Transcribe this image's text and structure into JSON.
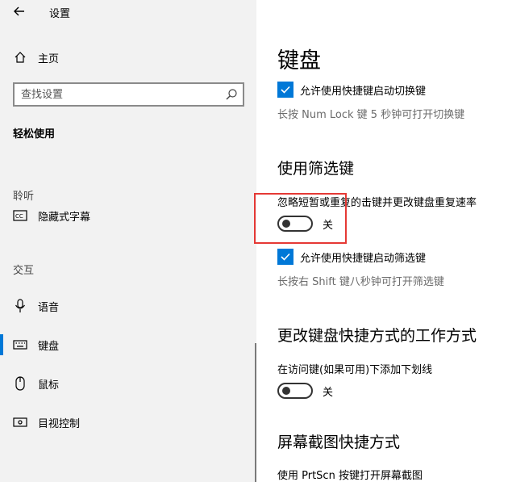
{
  "window": {
    "title": "设置"
  },
  "sidebar": {
    "home_label": "主页",
    "search_placeholder": "查找设置",
    "category": "轻松使用",
    "groups": [
      {
        "label": "聆听",
        "items": [
          {
            "label": "隐藏式字幕",
            "icon": "closed-captions-icon"
          }
        ]
      },
      {
        "label": "交互",
        "items": [
          {
            "label": "语音",
            "icon": "microphone-icon"
          },
          {
            "label": "键盘",
            "icon": "keyboard-icon",
            "selected": true
          },
          {
            "label": "鼠标",
            "icon": "mouse-icon"
          },
          {
            "label": "目视控制",
            "icon": "eye-control-icon"
          }
        ]
      }
    ]
  },
  "main": {
    "title": "键盘",
    "toggle_keys_shortcut": {
      "label": "允许使用快捷键启动切换键",
      "checked": true,
      "desc": "长按 Num Lock 键 5 秒钟可打开切换键"
    },
    "filter_keys": {
      "heading": "使用筛选键",
      "setting_label": "忽略短暂或重复的击键并更改键盘重复速率",
      "toggle_state": "关",
      "shortcut_label": "允许使用快捷键启动筛选键",
      "shortcut_checked": true,
      "desc": "长按右 Shift 键八秒钟可打开筛选键"
    },
    "shortcuts_section": {
      "heading": "更改键盘快捷方式的工作方式",
      "setting_label": "在访问键(如果可用)下添加下划线",
      "toggle_state": "关"
    },
    "screenshot_section": {
      "heading": "屏幕截图快捷方式",
      "setting_label": "使用 PrtScn 按键打开屏幕截图"
    }
  },
  "colors": {
    "accent": "#0078d7",
    "highlight": "#e53935",
    "sidebar_bg": "#f2f2f2"
  }
}
